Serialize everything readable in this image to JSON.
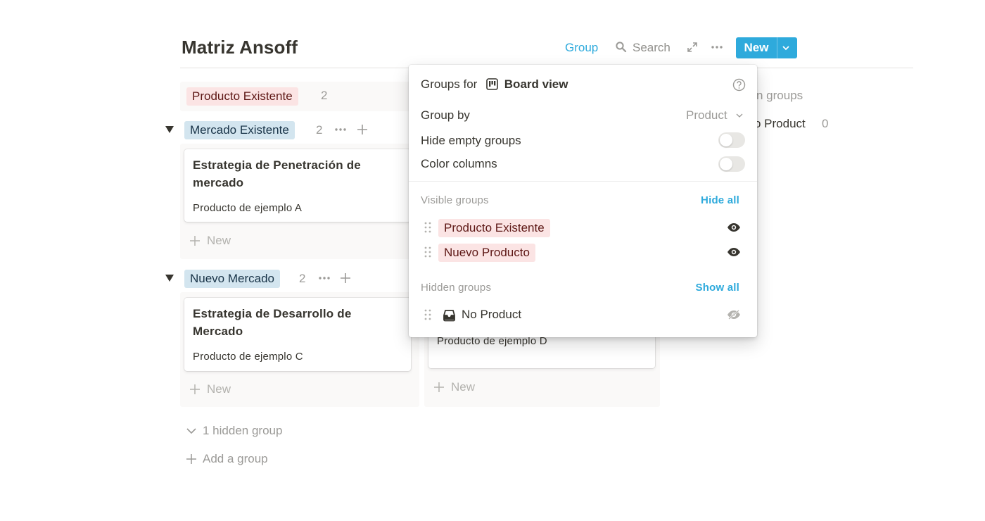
{
  "page": {
    "title": "Matriz Ansoff"
  },
  "toolbar": {
    "group_label": "Group",
    "search_label": "Search",
    "new_label": "New",
    "accent_color": "#2eaadc"
  },
  "board": {
    "visible_column": {
      "label": "Producto Existente",
      "count": "2",
      "color": "#fbe4e4"
    },
    "hidden_column": {
      "header_partial": "n groups",
      "item_label": "o Product",
      "item_count": "0"
    },
    "groups": [
      {
        "label": "Mercado Existente",
        "count": "2",
        "color": "#d3e5ef",
        "card": {
          "title": "Estrategia de Penetración de mercado",
          "property": "Producto de ejemplo A"
        },
        "new_label": "New"
      },
      {
        "label": "Nuevo Mercado",
        "count": "2",
        "color": "#d3e5ef",
        "card": {
          "title": "Estrategia de Desarrollo de Mercado",
          "property": "Producto de ejemplo C"
        },
        "new_label": "New",
        "second_card_property": "Producto de ejemplo D",
        "second_new_label": "New"
      }
    ],
    "hidden_groups_label": "1 hidden group",
    "add_group_label": "Add a group"
  },
  "popup": {
    "title_prefix": "Groups for",
    "view_name": "Board view",
    "group_by_label": "Group by",
    "group_by_value": "Product",
    "hide_empty_label": "Hide empty groups",
    "hide_empty_on": false,
    "color_columns_label": "Color columns",
    "color_columns_on": false,
    "visible_section": "Visible groups",
    "hide_all_label": "Hide all",
    "visible_groups": [
      {
        "label": "Producto Existente",
        "color": "#fbe4e4"
      },
      {
        "label": "Nuevo Producto",
        "color": "#fbe4e4"
      }
    ],
    "hidden_section": "Hidden groups",
    "show_all_label": "Show all",
    "hidden_groups": [
      {
        "label": "No Product",
        "icon": "inbox-icon"
      }
    ]
  }
}
